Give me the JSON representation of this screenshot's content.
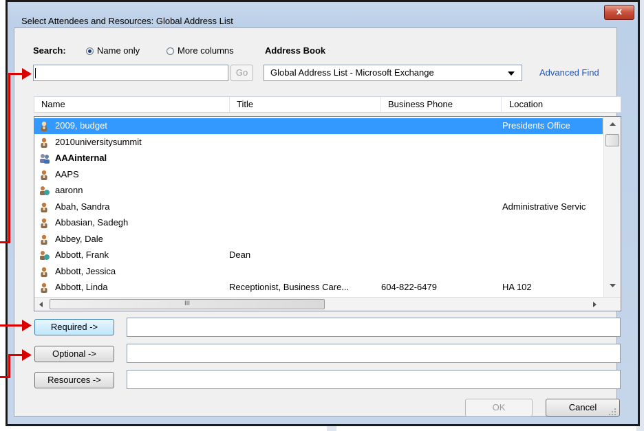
{
  "window": {
    "title": "Select Attendees and Resources: Global Address List",
    "close_glyph": "x"
  },
  "search": {
    "label": "Search:",
    "options": [
      "Name only",
      "More columns"
    ],
    "selected": "Name only",
    "value": "",
    "go_label": "Go"
  },
  "address_book": {
    "label": "Address Book",
    "value": "Global Address List - Microsoft Exchange",
    "advanced_find": "Advanced Find"
  },
  "columns": [
    "Name",
    "Title",
    "Business Phone",
    "Location"
  ],
  "rows": [
    {
      "name": "2009, budget",
      "title": "",
      "phone": "",
      "location": "Presidents Office",
      "icon": "user-icon",
      "selected": true,
      "bold": false
    },
    {
      "name": "2010universitysummit",
      "title": "",
      "phone": "",
      "location": "",
      "icon": "user-icon",
      "selected": false,
      "bold": false
    },
    {
      "name": "AAAinternal",
      "title": "",
      "phone": "",
      "location": "",
      "icon": "group-icon",
      "selected": false,
      "bold": true
    },
    {
      "name": "AAPS",
      "title": "",
      "phone": "",
      "location": "",
      "icon": "user-icon",
      "selected": false,
      "bold": false
    },
    {
      "name": "aaronn",
      "title": "",
      "phone": "",
      "location": "",
      "icon": "contact-icon",
      "selected": false,
      "bold": false
    },
    {
      "name": "Abah, Sandra",
      "title": "",
      "phone": "",
      "location": "Administrative Servic",
      "icon": "user-icon",
      "selected": false,
      "bold": false
    },
    {
      "name": "Abbasian, Sadegh",
      "title": "",
      "phone": "",
      "location": "",
      "icon": "user-icon",
      "selected": false,
      "bold": false
    },
    {
      "name": "Abbey, Dale",
      "title": "",
      "phone": "",
      "location": "",
      "icon": "user-icon",
      "selected": false,
      "bold": false
    },
    {
      "name": "Abbott, Frank",
      "title": "Dean",
      "phone": "",
      "location": "",
      "icon": "contact-icon",
      "selected": false,
      "bold": false
    },
    {
      "name": "Abbott, Jessica",
      "title": "",
      "phone": "",
      "location": "",
      "icon": "user-icon",
      "selected": false,
      "bold": false
    },
    {
      "name": "Abbott, Linda",
      "title": "Receptionist, Business Care...",
      "phone": "604-822-6479",
      "location": "HA 102",
      "icon": "user-icon",
      "selected": false,
      "bold": false
    }
  ],
  "hscroll_glyph": "III",
  "recipients": {
    "required_label": "Required ->",
    "required_value": "",
    "optional_label": "Optional ->",
    "optional_value": "",
    "resources_label": "Resources ->",
    "resources_value": ""
  },
  "footer": {
    "ok_label": "OK",
    "cancel_label": "Cancel"
  },
  "colors": {
    "selection": "#3399ff",
    "link": "#1a55c4",
    "annotation_arrow": "#d90000",
    "close_button": "#c9503a"
  }
}
